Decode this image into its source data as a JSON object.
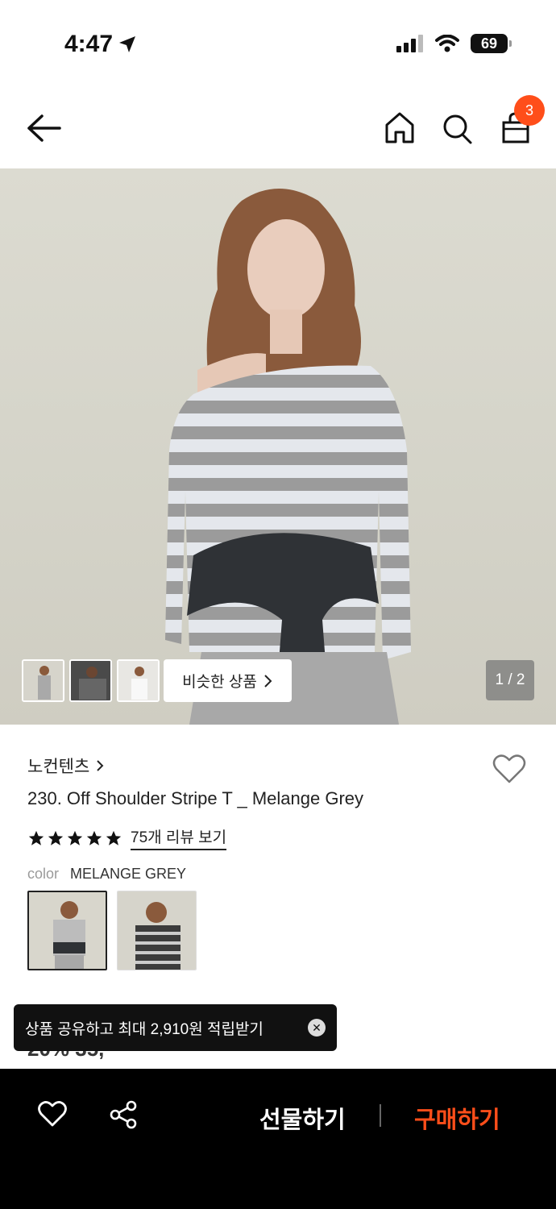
{
  "status_bar": {
    "time": "4:47",
    "battery": "69"
  },
  "nav": {
    "cart_count": "3"
  },
  "hero": {
    "similar_label": "비슷한 상품",
    "page_indicator": "1 / 2"
  },
  "product": {
    "brand": "노컨텐츠",
    "title": "230. Off Shoulder Stripe T _ Melange Grey",
    "rating_stars": 5,
    "review_link": "75개 리뷰 보기",
    "color_label": "color",
    "color_value": "MELANGE GREY",
    "price_peek": "20% 35,"
  },
  "toast": {
    "text": "상품 공유하고 최대 2,910원 적립받기"
  },
  "bottom_bar": {
    "gift_label": "선물하기",
    "buy_label": "구매하기"
  },
  "colors": {
    "accent": "#ff4e1a",
    "bar_bg": "#000000"
  },
  "icons": [
    "back-arrow-icon",
    "home-icon",
    "search-icon",
    "bag-icon",
    "heart-icon",
    "share-icon",
    "close-icon",
    "star-icon",
    "chevron-right-icon",
    "location-arrow-icon",
    "signal-icon",
    "wifi-icon",
    "battery-icon"
  ]
}
